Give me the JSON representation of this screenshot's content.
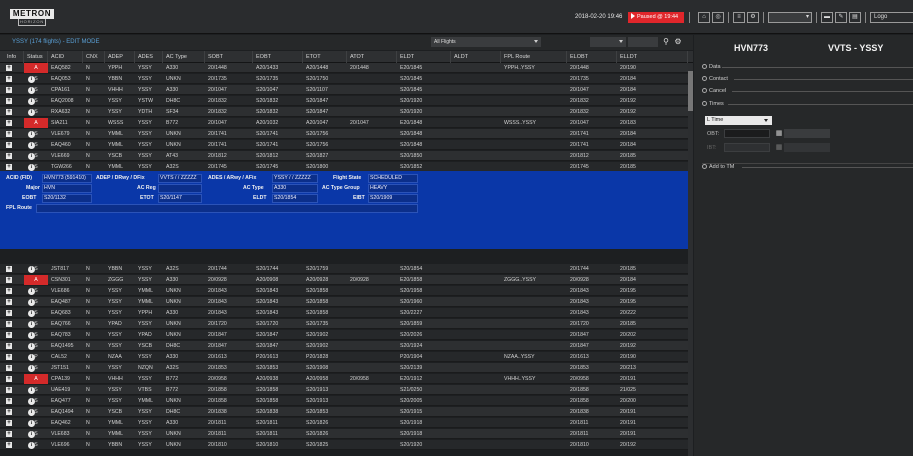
{
  "app": {
    "logo_top": "METRON",
    "logo_bottom": "HORIZON",
    "datetime": "2018-02-20 19:46",
    "paused_label": "Paused @ 19:44",
    "logout_label": "Logo"
  },
  "list": {
    "title": "YSSY (174 flights) - EDIT MODE",
    "filter_value": "All Flights",
    "search_value": ""
  },
  "columns": [
    "Info",
    "Status",
    "ACID",
    "CNX",
    "ADEP",
    "ADES",
    "AC Type",
    "SOBT",
    "EOBT",
    "ETOT",
    "ATOT",
    "ELDT",
    "ALDT",
    "FPL Route",
    "ELOBT",
    "ELLDT"
  ],
  "rows": [
    [
      "A",
      "EAQ582",
      "N",
      "YPPH",
      "YSSY",
      "A330",
      "20/1448",
      "A20/1433",
      "A20/1448",
      "20/1448",
      "E20/1845",
      "",
      "YPPH..YSSY",
      "20/1448",
      "20/190"
    ],
    [
      "S",
      "EAQ053",
      "N",
      "YBBN",
      "YSSY",
      "UNKN",
      "20/1735",
      "S20/1735",
      "S20/1750",
      "",
      "S20/1845",
      "",
      "",
      "20/1735",
      "20/184"
    ],
    [
      "S",
      "CPA161",
      "N",
      "VHHH",
      "YSSY",
      "A330",
      "20/1047",
      "S20/1047",
      "S20/1107",
      "",
      "S20/1845",
      "",
      "",
      "20/1047",
      "20/184"
    ],
    [
      "S",
      "EAQ2008",
      "N",
      "YSSY",
      "YSTW",
      "DH8C",
      "20/1832",
      "S20/1832",
      "S20/1847",
      "",
      "S20/1920",
      "",
      "",
      "20/1832",
      "20/192"
    ],
    [
      "S",
      "RXA632",
      "N",
      "YSSY",
      "YDTH",
      "SF34",
      "20/1832",
      "S20/1832",
      "S20/1847",
      "",
      "S20/1920",
      "",
      "",
      "20/1832",
      "20/192"
    ],
    [
      "A",
      "SIA211",
      "N",
      "WSSS",
      "YSSY",
      "B772",
      "20/1047",
      "A20/1032",
      "A20/1047",
      "20/1047",
      "E20/1848",
      "",
      "WSSS..YSSY",
      "20/1047",
      "20/183"
    ],
    [
      "S",
      "VLE679",
      "N",
      "YMML",
      "YSSY",
      "UNKN",
      "20/1741",
      "S20/1741",
      "S20/1756",
      "",
      "S20/1848",
      "",
      "",
      "20/1741",
      "20/184"
    ],
    [
      "S",
      "EAQ460",
      "N",
      "YMML",
      "YSSY",
      "UNKN",
      "20/1741",
      "S20/1741",
      "S20/1756",
      "",
      "S20/1848",
      "",
      "",
      "20/1741",
      "20/184"
    ],
    [
      "S",
      "VLE669",
      "N",
      "YSCB",
      "YSSY",
      "AT43",
      "20/1812",
      "S20/1812",
      "S20/1827",
      "",
      "S20/1850",
      "",
      "",
      "20/1812",
      "20/185"
    ],
    [
      "S",
      "TGW266",
      "N",
      "YMML",
      "YSSY",
      "A32S",
      "20/1745",
      "S20/1745",
      "S20/1800",
      "",
      "S20/1852",
      "",
      "",
      "20/1745",
      "20/185"
    ],
    [
      "S",
      "HVN773",
      "N",
      "VVTS",
      "YSSY",
      "A330",
      "20/1132",
      "S20/1132",
      "S20/1147",
      "",
      "S20/1854",
      "",
      "",
      "20/1132",
      "20/185"
    ],
    [
      "S",
      "JST817",
      "N",
      "YBBN",
      "YSSY",
      "A32S",
      "20/1744",
      "S20/1744",
      "S20/1759",
      "",
      "S20/1854",
      "",
      "",
      "20/1744",
      "20/185"
    ],
    [
      "A",
      "CSN301",
      "N",
      "ZGGG",
      "YSSY",
      "A330",
      "20/0928",
      "A20/0908",
      "A20/0928",
      "20/0928",
      "E20/1858",
      "",
      "ZGGG..YSSY",
      "20/0928",
      "20/184"
    ],
    [
      "S",
      "VLE686",
      "N",
      "YSSY",
      "YMML",
      "UNKN",
      "20/1843",
      "S20/1843",
      "S20/1858",
      "",
      "S20/1958",
      "",
      "",
      "20/1843",
      "20/195"
    ],
    [
      "S",
      "EAQ487",
      "N",
      "YSSY",
      "YMML",
      "UNKN",
      "20/1843",
      "S20/1843",
      "S20/1858",
      "",
      "S20/1960",
      "",
      "",
      "20/1843",
      "20/195"
    ],
    [
      "S",
      "EAQ683",
      "N",
      "YSSY",
      "YPPH",
      "A330",
      "20/1843",
      "S20/1843",
      "S20/1858",
      "",
      "S20/2227",
      "",
      "",
      "20/1843",
      "20/222"
    ],
    [
      "S",
      "EAQ766",
      "N",
      "YPAD",
      "YSSY",
      "UNKN",
      "20/1720",
      "S20/1720",
      "S20/1735",
      "",
      "S20/1859",
      "",
      "",
      "20/1720",
      "20/185"
    ],
    [
      "S",
      "EAQ783",
      "N",
      "YSSY",
      "YPAD",
      "UNKN",
      "20/1847",
      "S20/1847",
      "S20/1902",
      "",
      "S20/2026",
      "",
      "",
      "20/1847",
      "20/202"
    ],
    [
      "S",
      "EAQ1495",
      "N",
      "YSSY",
      "YSCB",
      "DH8C",
      "20/1847",
      "S20/1847",
      "S20/1902",
      "",
      "S20/1924",
      "",
      "",
      "20/1847",
      "20/192"
    ],
    [
      "P",
      "CAL52",
      "N",
      "NZAA",
      "YSSY",
      "A330",
      "20/1613",
      "P20/1613",
      "P20/1828",
      "",
      "P20/1904",
      "",
      "NZAA..YSSY",
      "20/1613",
      "20/190"
    ],
    [
      "S",
      "JST151",
      "N",
      "YSSY",
      "NZQN",
      "A32S",
      "20/1853",
      "S20/1853",
      "S20/1908",
      "",
      "S20/2139",
      "",
      "",
      "20/1853",
      "20/213"
    ],
    [
      "A",
      "CPA139",
      "N",
      "VHHH",
      "YSSY",
      "B772",
      "20/0958",
      "A20/0938",
      "A20/0958",
      "20/0958",
      "E20/1912",
      "",
      "VHHH..YSSY",
      "20/0958",
      "20/191"
    ],
    [
      "S",
      "UAE419",
      "N",
      "YSSY",
      "VTBS",
      "B772",
      "20/1858",
      "S20/1858",
      "S20/1913",
      "",
      "S21/0250",
      "",
      "",
      "20/1858",
      "21/025"
    ],
    [
      "S",
      "EAQ477",
      "N",
      "YSSY",
      "YMML",
      "UNKN",
      "20/1858",
      "S20/1858",
      "S20/1913",
      "",
      "S20/2005",
      "",
      "",
      "20/1858",
      "20/200"
    ],
    [
      "S",
      "EAQ1494",
      "N",
      "YSCB",
      "YSSY",
      "DH8C",
      "20/1838",
      "S20/1838",
      "S20/1853",
      "",
      "S20/1915",
      "",
      "",
      "20/1838",
      "20/191"
    ],
    [
      "S",
      "EAQ462",
      "N",
      "YMML",
      "YSSY",
      "A330",
      "20/1811",
      "S20/1811",
      "S20/1826",
      "",
      "S20/1918",
      "",
      "",
      "20/1811",
      "20/191"
    ],
    [
      "S",
      "VLE683",
      "N",
      "YMML",
      "YSSY",
      "UNKN",
      "20/1811",
      "S20/1811",
      "S20/1826",
      "",
      "S20/1918",
      "",
      "",
      "20/1811",
      "20/191"
    ],
    [
      "S",
      "VLE696",
      "N",
      "YBBN",
      "YSSY",
      "UNKN",
      "20/1810",
      "S20/1810",
      "S20/1825",
      "",
      "S20/1920",
      "",
      "",
      "20/1810",
      "20/192"
    ]
  ],
  "detail": {
    "acid_label": "ACID (FID)",
    "acid_value": "HVN773 (591410)",
    "adep_label": "ADEP / DRwy / DFix",
    "adep_value": "VVTS / / ZZZZZ",
    "ades_label": "ADES / ARwy / AFix",
    "ades_value": "YSSY / / ZZZZZ",
    "flight_state_label": "Flight State",
    "flight_state_value": "SCHEDULED",
    "major_label": "Major",
    "major_value": "HVN",
    "ac_reg_label": "AC Reg",
    "ac_reg_value": "",
    "ac_type_label": "AC Type",
    "ac_type_value": "A330",
    "ac_type_group_label": "AC Type Group",
    "ac_type_group_value": "HEAVY",
    "eobt_label": "EOBT",
    "eobt_value": "S20/1132",
    "etot_label": "ETOT",
    "etot_value": "S20/1147",
    "eldt_label": "ELDT",
    "eldt_value": "S20/1854",
    "eibt_label": "EIBT",
    "eibt_value": "S20/1909",
    "fpl_route_label": "FPL Route",
    "fpl_route_value": ""
  },
  "panel": {
    "flight": "HVN773",
    "route": "VVTS - YSSY",
    "sections": [
      "Data",
      "Contact",
      "Cancel",
      "Times"
    ],
    "time_select": "L Time",
    "obt_label": "OBT:",
    "ibt_label": "IBT:",
    "add_tm": "Add to TM"
  },
  "colors": {
    "accent": "#5aa0d6",
    "selected_row": "#15378c",
    "status_active": "#d42a2a",
    "paused": "#e0262b"
  }
}
